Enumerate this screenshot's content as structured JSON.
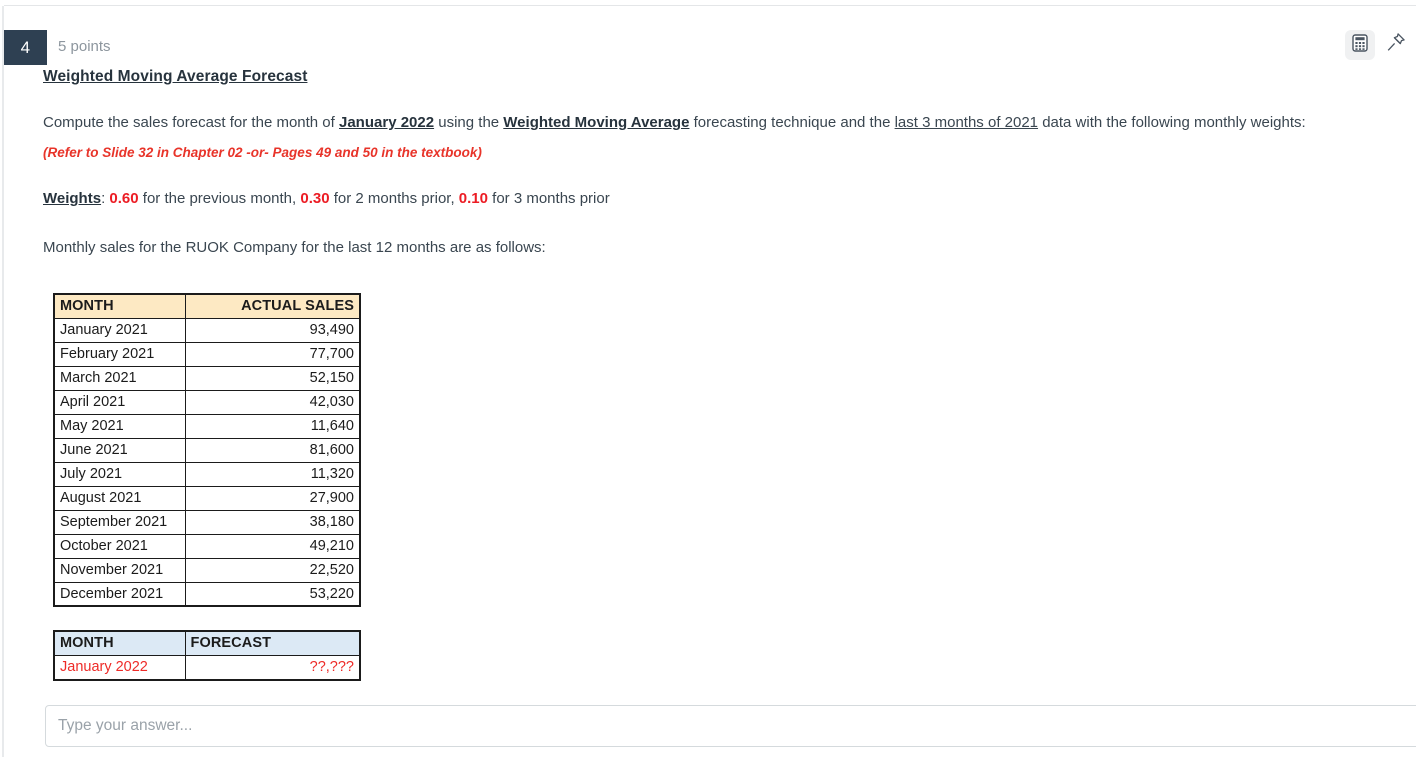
{
  "question": {
    "number": "4",
    "points": "5 points",
    "title": "Weighted Moving Average Forecast"
  },
  "header": {
    "calculator_icon": "calculator-icon",
    "pin_icon": "pushpin-icon"
  },
  "prompt": {
    "part1": "Compute the sales forecast for the month of ",
    "target_month": "January 2022",
    "part2": " using the ",
    "technique": "Weighted Moving Average",
    "part3": " forecasting technique and the ",
    "data_range": "last 3 months of 2021",
    "part4": " data with the following monthly weights:",
    "reference_note": "(Refer to Slide 32 in Chapter 02 -or- Pages 49 and 50 in the textbook)",
    "weights_label": "Weights",
    "weights_colon": ": ",
    "weight1": "0.60",
    "weight1_text": " for the previous month, ",
    "weight2": "0.30",
    "weight2_text": " for 2 months prior, ",
    "weight3": "0.10",
    "weight3_text": " for 3 months prior",
    "sales_intro": "Monthly sales for the RUOK Company for the last 12 months are as follows:"
  },
  "sales_table": {
    "headers": [
      "MONTH",
      "ACTUAL SALES"
    ],
    "rows": [
      [
        "January 2021",
        "93,490"
      ],
      [
        "February 2021",
        "77,700"
      ],
      [
        "March 2021",
        "52,150"
      ],
      [
        "April 2021",
        "42,030"
      ],
      [
        "May 2021",
        "11,640"
      ],
      [
        "June 2021",
        "81,600"
      ],
      [
        "July 2021",
        "11,320"
      ],
      [
        "August 2021",
        "27,900"
      ],
      [
        "September 2021",
        "38,180"
      ],
      [
        "October 2021",
        "49,210"
      ],
      [
        "November 2021",
        "22,520"
      ],
      [
        "December 2021",
        "53,220"
      ]
    ]
  },
  "forecast_table": {
    "headers": [
      "MONTH",
      "FORECAST"
    ],
    "rows": [
      [
        "January 2022",
        "??,???"
      ]
    ]
  },
  "answer": {
    "value": "",
    "placeholder": "Type your answer..."
  },
  "colors": {
    "badge_bg": "#2e4052",
    "accent_red": "#ec1c24",
    "sales_header_bg": "#fde9c3",
    "forecast_header_bg": "#dce9f5"
  }
}
